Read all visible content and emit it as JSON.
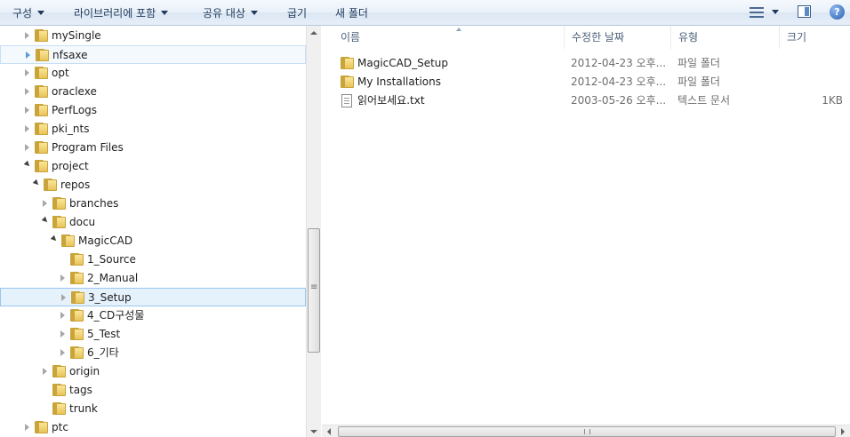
{
  "toolbar": {
    "organize": "구성",
    "include_in_library": "라이브러리에 포함",
    "share_with": "공유 대상",
    "burn": "굽기",
    "new_folder": "새 폴더",
    "help": "?"
  },
  "tree": [
    {
      "label": "mySingle",
      "state": "collapsed"
    },
    {
      "label": "nfsaxe",
      "state": "collapsed",
      "highlight": "hover"
    },
    {
      "label": "opt",
      "state": "collapsed"
    },
    {
      "label": "oraclexe",
      "state": "collapsed"
    },
    {
      "label": "PerfLogs",
      "state": "collapsed"
    },
    {
      "label": "pki_nts",
      "state": "collapsed"
    },
    {
      "label": "Program Files",
      "state": "collapsed"
    },
    {
      "label": "project",
      "state": "expanded"
    },
    {
      "label": "repos",
      "state": "expanded"
    },
    {
      "label": "branches",
      "state": "collapsed"
    },
    {
      "label": "docu",
      "state": "expanded"
    },
    {
      "label": "MagicCAD",
      "state": "expanded"
    },
    {
      "label": "1_Source",
      "state": "none"
    },
    {
      "label": "2_Manual",
      "state": "collapsed"
    },
    {
      "label": "3_Setup",
      "state": "collapsed",
      "highlight": "selected"
    },
    {
      "label": "4_CD구성물",
      "state": "collapsed"
    },
    {
      "label": "5_Test",
      "state": "collapsed"
    },
    {
      "label": "6_기타",
      "state": "collapsed"
    },
    {
      "label": "origin",
      "state": "collapsed"
    },
    {
      "label": "tags",
      "state": "none"
    },
    {
      "label": "trunk",
      "state": "none"
    },
    {
      "label": "ptc",
      "state": "collapsed"
    }
  ],
  "columns": {
    "name": "이름",
    "date": "수정한 날짜",
    "type": "유형",
    "size": "크기"
  },
  "files": [
    {
      "name": "MagicCAD_Setup",
      "date": "2012-04-23 오후...",
      "type": "파일 폴더",
      "size": "",
      "icon": "folder-icon"
    },
    {
      "name": "My Installations",
      "date": "2012-04-23 오후...",
      "type": "파일 폴더",
      "size": "",
      "icon": "folder-icon"
    },
    {
      "name": "읽어보세요.txt",
      "date": "2003-05-26 오후...",
      "type": "텍스트 문서",
      "size": "1KB",
      "icon": "text-file-icon"
    }
  ]
}
